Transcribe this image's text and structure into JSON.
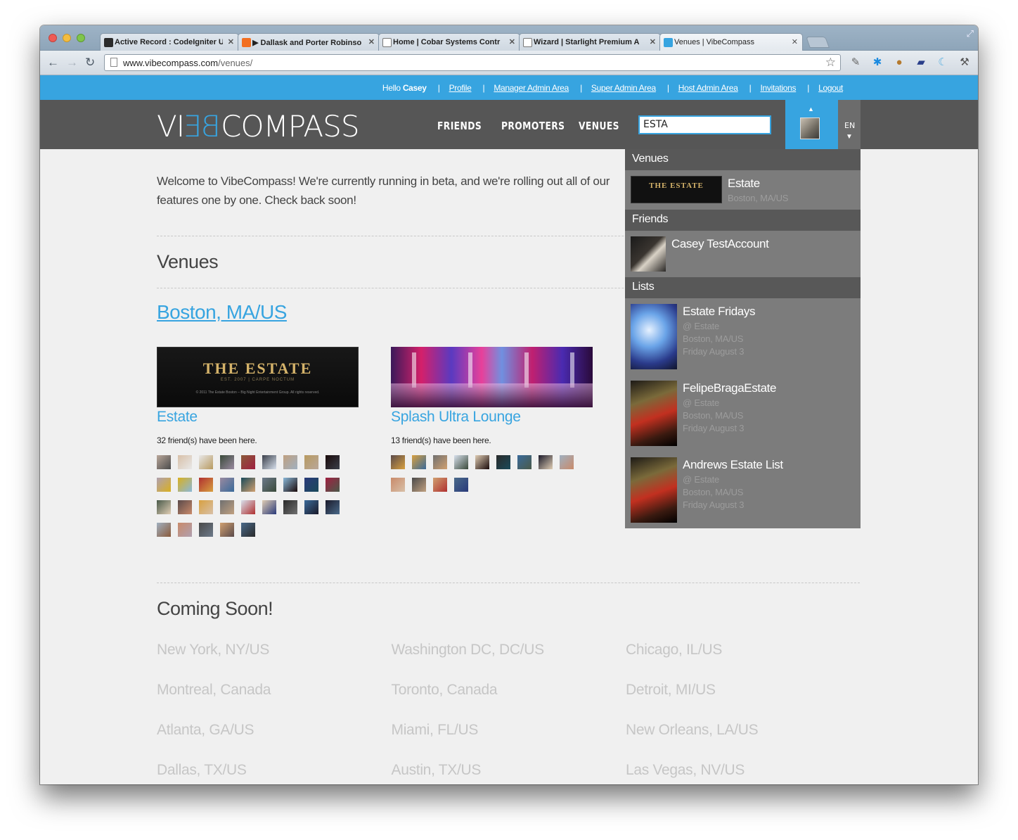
{
  "browser": {
    "tabs": [
      {
        "title": "Active Record : CodeIgniter U",
        "fav": "#2b2b2b"
      },
      {
        "title": "▶ Dallask and Porter Robinso",
        "fav": "#f26f21"
      },
      {
        "title": "Home | Cobar Systems Contr",
        "fav": "#ffffff"
      },
      {
        "title": "Wizard | Starlight Premium A",
        "fav": "#ffffff"
      },
      {
        "title": "Venues | VibeCompass",
        "fav": "#37a4e0"
      }
    ],
    "url_host": "www.vibecompass.com",
    "url_path": "/venues/"
  },
  "topbar": {
    "hello": "Hello",
    "user": "Casey",
    "links": [
      "Profile",
      "Manager Admin Area",
      "Super Admin Area",
      "Host Admin Area",
      "Invitations",
      "Logout"
    ]
  },
  "header": {
    "logo_left": "VI",
    "logo_be": "BE",
    "logo_right": "COMPASS",
    "nav": [
      "FRIENDS",
      "PROMOTERS",
      "VENUES"
    ],
    "search_value": "ESTA",
    "lang": "EN"
  },
  "main": {
    "welcome": "Welcome to VibeCompass! We're currently running in beta, and we're rolling out all of our features one by one. Check back soon!",
    "venues_heading": "Venues",
    "city": "Boston, MA/US",
    "venues": [
      {
        "name": "Estate",
        "friends_text": "32 friend(s) have been here.",
        "img_title": "THE ESTATE",
        "img_sub": "EST. 2007  |  CARPE NOCTUM",
        "img_copy": "© 2011 The Estate Boston – Big Night Entertainment Group. All rights reserved.",
        "thumbs": 32
      },
      {
        "name": "Splash Ultra Lounge",
        "friends_text": "13 friend(s) have been here.",
        "thumbs": 13
      }
    ],
    "coming_heading": "Coming Soon!",
    "coming_soon": [
      "New York, NY/US",
      "Washington DC, DC/US",
      "Chicago, IL/US",
      "Montreal, Canada",
      "Toronto, Canada",
      "Detroit, MI/US",
      "Atlanta, GA/US",
      "Miami, FL/US",
      "New Orleans, LA/US",
      "Dallas, TX/US",
      "Austin, TX/US",
      "Las Vegas, NV/US"
    ]
  },
  "dropdown": {
    "venues_label": "Venues",
    "venue": {
      "name": "Estate",
      "location": "Boston, MA/US",
      "thumb_title": "THE ESTATE"
    },
    "friends_label": "Friends",
    "friend": {
      "name": "Casey TestAccount"
    },
    "lists_label": "Lists",
    "lists": [
      {
        "name": "Estate Fridays",
        "venue": "@ Estate",
        "location": "Boston, MA/US",
        "date": "Friday August 3"
      },
      {
        "name": "FelipeBragaEstate",
        "venue": "@ Estate",
        "location": "Boston, MA/US",
        "date": "Friday August 3"
      },
      {
        "name": "Andrews Estate List",
        "venue": "@ Estate",
        "location": "Boston, MA/US",
        "date": "Friday August 3"
      }
    ]
  },
  "colors": {
    "accent": "#37a4e0",
    "header_bg": "#565656",
    "dropdown_bg": "#7c7c7c",
    "dropdown_section": "#585858"
  }
}
